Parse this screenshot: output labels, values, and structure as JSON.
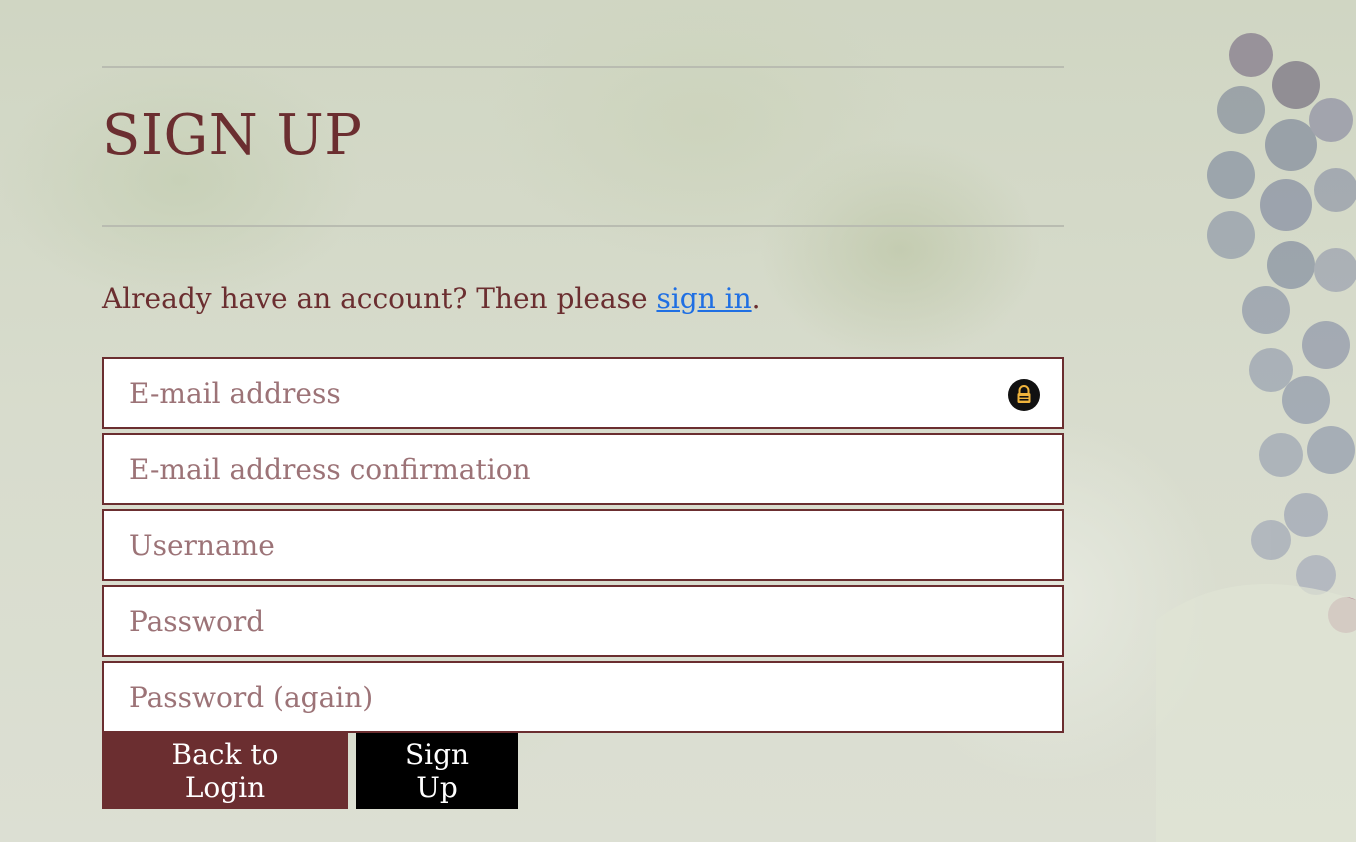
{
  "page": {
    "title": "SIGN UP",
    "lead_text": "Already have an account? Then please ",
    "lead_link": "sign in",
    "lead_end": "."
  },
  "form": {
    "email_placeholder": "E-mail address",
    "email_confirm_placeholder": "E-mail address confirmation",
    "username_placeholder": "Username",
    "password_placeholder": "Password",
    "password_again_placeholder": "Password (again)"
  },
  "buttons": {
    "back_label": "Back to Login",
    "signup_label": "Sign Up"
  },
  "icons": {
    "password_manager": "lock-icon"
  },
  "colors": {
    "brand": "#6b2e30",
    "link": "#1f6fe3",
    "primary_button": "#000000",
    "secondary_button": "#6b2e30"
  }
}
